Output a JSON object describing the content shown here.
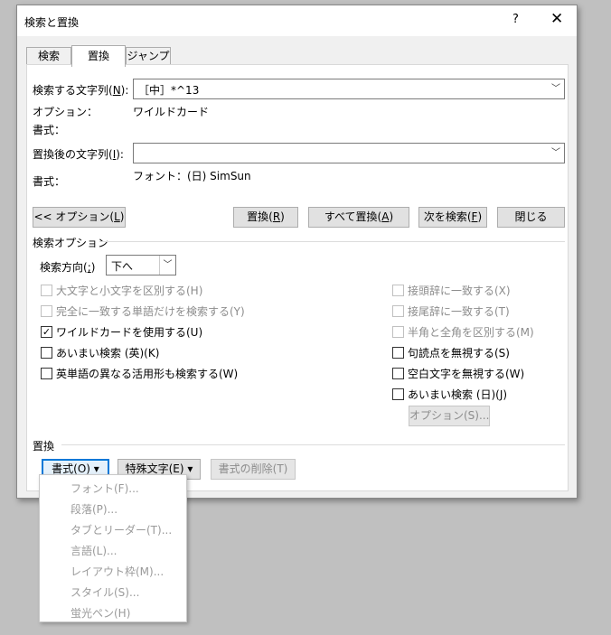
{
  "window": {
    "title": "検索と置換",
    "help": "?",
    "close": "✕"
  },
  "tabs": [
    "検索",
    "置換",
    "ジャンプ"
  ],
  "find": {
    "label": "検索する文字列(",
    "key": "N",
    "end": "):",
    "value": "［中］*^13"
  },
  "options_line": {
    "label": "オプション：",
    "value": "ワイルドカード"
  },
  "find_format_label": "書式：",
  "replace": {
    "label": "置換後の文字列(",
    "key": "I",
    "end": "):",
    "value": ""
  },
  "replace_format": {
    "label": "書式：",
    "value": "フォント：(日) SimSun"
  },
  "buttons": {
    "options": {
      "pre": "<< オプション(",
      "key": "L",
      "end": ")"
    },
    "replace": {
      "pre": "置換(",
      "key": "R",
      "end": ")"
    },
    "replace_all": {
      "pre": "すべて置換(",
      "key": "A",
      "end": ")"
    },
    "find_next": {
      "pre": "次を検索(",
      "key": "F",
      "end": ")"
    },
    "close": "閉じる"
  },
  "search_options": {
    "title": "検索オプション",
    "direction_label": {
      "pre": "検索方向(",
      "key": ";",
      "end": ")"
    },
    "direction_value": "下へ"
  },
  "checkboxes_left": [
    {
      "label": "大文字と小文字を区別する(H)",
      "checked": "",
      "enabled": false
    },
    {
      "label": "完全に一致する単語だけを検索する(Y)",
      "checked": "",
      "enabled": false
    },
    {
      "label": "ワイルドカードを使用する(U)",
      "checked": "✓",
      "enabled": true
    },
    {
      "label": "あいまい検索 (英)(K)",
      "checked": "",
      "enabled": true
    },
    {
      "label": "英単語の異なる活用形も検索する(W)",
      "checked": "",
      "enabled": true
    }
  ],
  "checkboxes_right": [
    {
      "label": "接頭辞に一致する(X)",
      "checked": "",
      "enabled": false
    },
    {
      "label": "接尾辞に一致する(T)",
      "checked": "",
      "enabled": false
    },
    {
      "label": "半角と全角を区別する(M)",
      "checked": "",
      "enabled": false
    },
    {
      "label": "句読点を無視する(S)",
      "checked": "",
      "enabled": true
    },
    {
      "label": "空白文字を無視する(W)",
      "checked": "",
      "enabled": true
    },
    {
      "label": "あいまい検索 (日)(J)",
      "checked": "",
      "enabled": true
    }
  ],
  "fuzzy_options_button": "オプション(S)...",
  "replace_section": {
    "title": "置換"
  },
  "bottom_buttons": {
    "format": "書式(O) ▾",
    "special": "特殊文字(E) ▾",
    "clear_format": "書式の削除(T)"
  },
  "format_menu": [
    "フォント(F)...",
    "段落(P)...",
    "タブとリーダー(T)...",
    "言語(L)...",
    "レイアウト枠(M)...",
    "スタイル(S)...",
    "蛍光ペン(H)"
  ]
}
